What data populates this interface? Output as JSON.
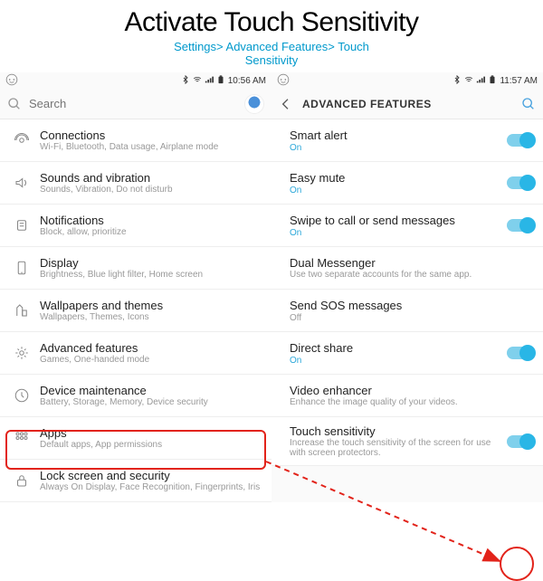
{
  "header": {
    "title": "Activate Touch Sensitivity",
    "breadcrumb_line1": "Settings> Advanced Features> Touch",
    "breadcrumb_line2": "Sensitivity"
  },
  "left": {
    "statusbar": {
      "time": "10:56 AM"
    },
    "search": {
      "placeholder": "Search"
    },
    "items": [
      {
        "name": "connections",
        "title": "Connections",
        "sub": "Wi-Fi, Bluetooth, Data usage, Airplane mode"
      },
      {
        "name": "sounds",
        "title": "Sounds and vibration",
        "sub": "Sounds, Vibration, Do not disturb"
      },
      {
        "name": "notifications",
        "title": "Notifications",
        "sub": "Block, allow, prioritize"
      },
      {
        "name": "display",
        "title": "Display",
        "sub": "Brightness, Blue light filter, Home screen"
      },
      {
        "name": "wallpapers",
        "title": "Wallpapers and themes",
        "sub": "Wallpapers, Themes, Icons"
      },
      {
        "name": "advanced-features",
        "title": "Advanced features",
        "sub": "Games, One-handed mode"
      },
      {
        "name": "device-maintenance",
        "title": "Device maintenance",
        "sub": "Battery, Storage, Memory, Device security"
      },
      {
        "name": "apps",
        "title": "Apps",
        "sub": "Default apps, App permissions"
      },
      {
        "name": "lock-screen",
        "title": "Lock screen and security",
        "sub": "Always On Display, Face Recognition, Fingerprints, Iris"
      }
    ]
  },
  "right": {
    "statusbar": {
      "time": "11:57 AM"
    },
    "header": {
      "title": "ADVANCED FEATURES"
    },
    "items": [
      {
        "name": "smart-alert",
        "title": "Smart alert",
        "state": "On",
        "toggle": "on"
      },
      {
        "name": "easy-mute",
        "title": "Easy mute",
        "state": "On",
        "toggle": "on"
      },
      {
        "name": "swipe-call",
        "title": "Swipe to call or send messages",
        "state": "On",
        "toggle": "on"
      },
      {
        "name": "dual-messenger",
        "title": "Dual Messenger",
        "sub": "Use two separate accounts for the same app."
      },
      {
        "name": "send-sos",
        "title": "Send SOS messages",
        "state": "Off"
      },
      {
        "name": "direct-share",
        "title": "Direct share",
        "state": "On",
        "toggle": "on"
      },
      {
        "name": "video-enhancer",
        "title": "Video enhancer",
        "sub": "Enhance the image quality of your videos."
      },
      {
        "name": "touch-sensitivity",
        "title": "Touch sensitivity",
        "sub": "Increase the touch sensitivity of the screen for use with screen protectors.",
        "toggle": "on"
      }
    ]
  }
}
